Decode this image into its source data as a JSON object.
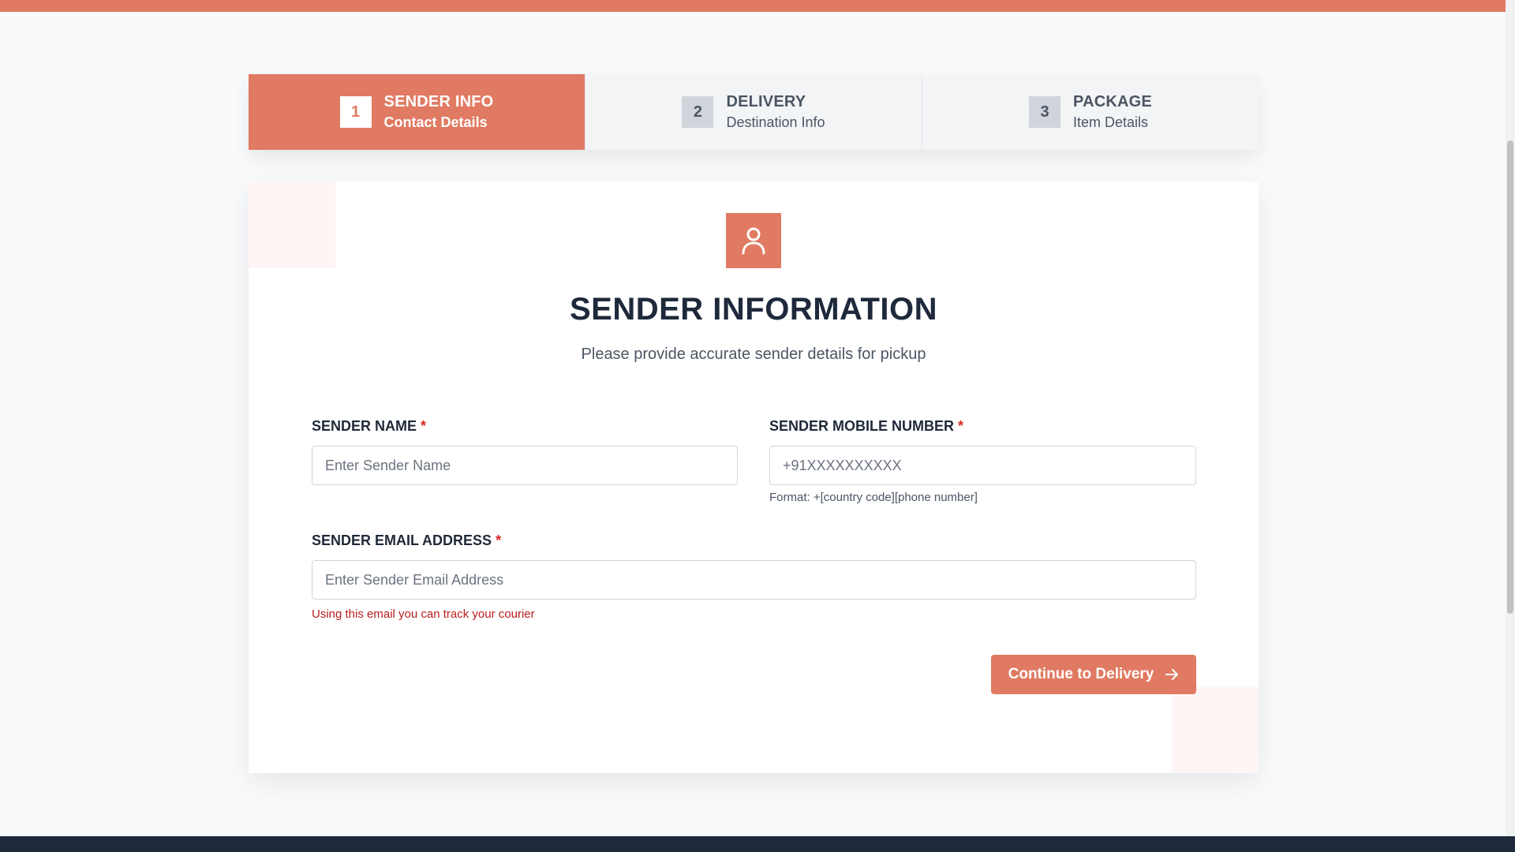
{
  "stepper": {
    "steps": [
      {
        "number": "1",
        "title": "SENDER INFO",
        "subtitle": "Contact Details"
      },
      {
        "number": "2",
        "title": "DELIVERY",
        "subtitle": "Destination Info"
      },
      {
        "number": "3",
        "title": "PACKAGE",
        "subtitle": "Item Details"
      }
    ],
    "active_index": 0
  },
  "card": {
    "icon": "user-icon",
    "title": "SENDER INFORMATION",
    "subtitle": "Please provide accurate sender details for pickup"
  },
  "form": {
    "sender_name": {
      "label": "SENDER NAME",
      "required_mark": "*",
      "placeholder": "Enter Sender Name",
      "value": ""
    },
    "sender_mobile": {
      "label": "SENDER MOBILE NUMBER",
      "required_mark": "*",
      "placeholder": "+91XXXXXXXXXX",
      "value": "",
      "hint": "Format: +[country code][phone number]"
    },
    "sender_email": {
      "label": "SENDER EMAIL ADDRESS",
      "required_mark": "*",
      "placeholder": "Enter Sender Email Address",
      "value": "",
      "hint": "Using this email you can track your courier"
    },
    "continue_label": "Continue to Delivery",
    "continue_icon": "arrow-right-icon"
  },
  "colors": {
    "accent": "#e07a62",
    "background": "#f8fafc",
    "footer": "#1e293b",
    "error_text": "#b91c1c"
  }
}
